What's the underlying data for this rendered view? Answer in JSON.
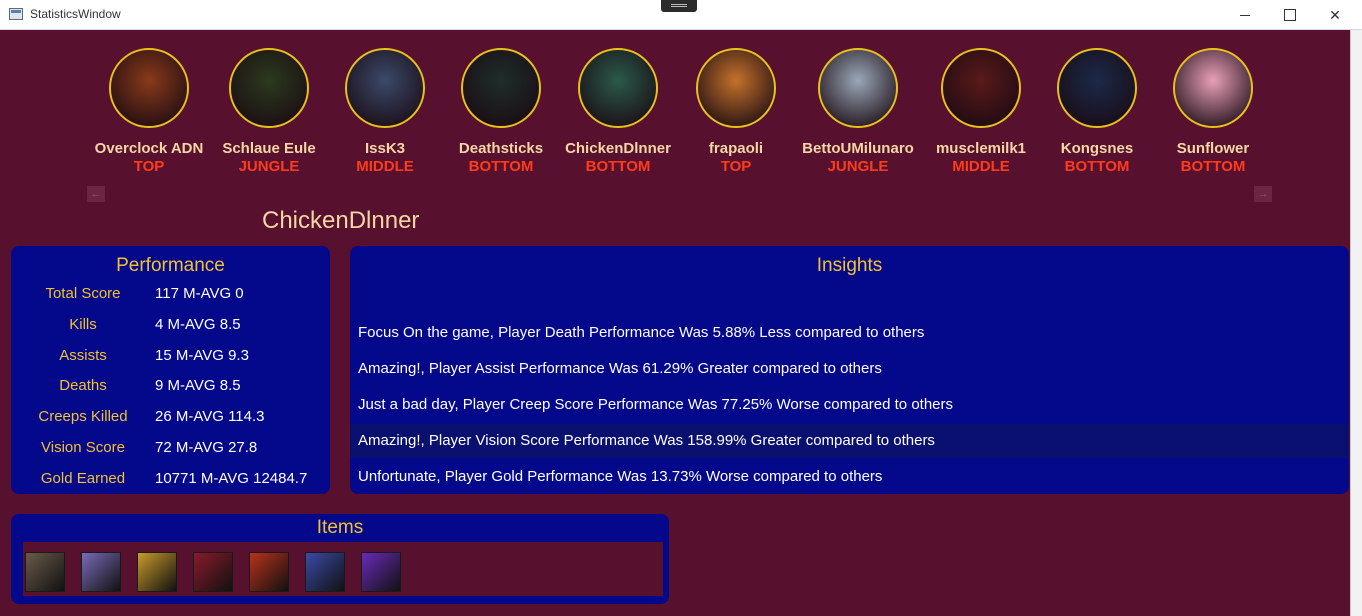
{
  "window": {
    "title": "StatisticsWindow"
  },
  "players": [
    {
      "name": "Overclock ADN",
      "role": "TOP",
      "color": "#8a3a1a",
      "icon": "champion-portrait-icon"
    },
    {
      "name": "Schlaue Eule",
      "role": "JUNGLE",
      "color": "#2b3a1e",
      "icon": "champion-portrait-icon"
    },
    {
      "name": "IssK3",
      "role": "MIDDLE",
      "color": "#3a4a6a",
      "icon": "champion-portrait-icon"
    },
    {
      "name": "Deathsticks",
      "role": "BOTTOM",
      "color": "#1e2e2a",
      "icon": "champion-portrait-icon"
    },
    {
      "name": "ChickenDlnner",
      "role": "BOTTOM",
      "color": "#2a5a4a",
      "icon": "champion-portrait-icon"
    },
    {
      "name": "frapaoli",
      "role": "TOP",
      "color": "#c4722a",
      "icon": "champion-portrait-icon"
    },
    {
      "name": "BettoUMilunaro",
      "role": "JUNGLE",
      "color": "#9aa8b8",
      "icon": "champion-portrait-icon"
    },
    {
      "name": "musclemilk1",
      "role": "MIDDLE",
      "color": "#5a1a1a",
      "icon": "champion-portrait-icon"
    },
    {
      "name": "Kongsnes",
      "role": "BOTTOM",
      "color": "#1a2a4a",
      "icon": "champion-portrait-icon"
    },
    {
      "name": "Sunflower",
      "role": "BOTTOM",
      "color": "#e8a0b8",
      "icon": "champion-portrait-icon"
    }
  ],
  "nav": {
    "prev": "←",
    "next": "→"
  },
  "selected_player": "ChickenDlnner",
  "performance": {
    "title": "Performance",
    "rows": [
      {
        "label": "Total Score",
        "value": "117 M-AVG 0"
      },
      {
        "label": "Kills",
        "value": "4 M-AVG 8.5"
      },
      {
        "label": "Assists",
        "value": "15 M-AVG 9.3"
      },
      {
        "label": "Deaths",
        "value": "9 M-AVG 8.5"
      },
      {
        "label": "Creeps Killed",
        "value": "26 M-AVG 114.3"
      },
      {
        "label": "Vision Score",
        "value": "72 M-AVG 27.8"
      },
      {
        "label": "Gold Earned",
        "value": "10771 M-AVG 12484.7"
      }
    ]
  },
  "insights": {
    "title": "Insights",
    "lines": [
      "Focus On the game, Player Death Performance Was 5.88% Less compared to others",
      "Amazing!, Player Assist Performance Was 61.29% Greater compared to others",
      "Just a bad day, Player Creep Score Performance Was 77.25% Worse compared to others",
      "Amazing!, Player Vision Score Performance Was 158.99% Greater compared to others",
      "Unfortunate, Player Gold Performance Was 13.73% Worse compared to others"
    ]
  },
  "items": {
    "title": "Items",
    "list": [
      {
        "icon": "stone-item-icon",
        "color": "#6a5a4a"
      },
      {
        "icon": "shield-item-icon",
        "color": "#7a6ab8"
      },
      {
        "icon": "hourglass-item-icon",
        "color": "#c89a2a"
      },
      {
        "icon": "boots-item-icon",
        "color": "#8a1a2a"
      },
      {
        "icon": "amulet-item-icon",
        "color": "#b8321a"
      },
      {
        "icon": "staff-item-icon",
        "color": "#3a4aa8"
      },
      {
        "icon": "orb-item-icon",
        "color": "#6a2ab8"
      }
    ]
  }
}
